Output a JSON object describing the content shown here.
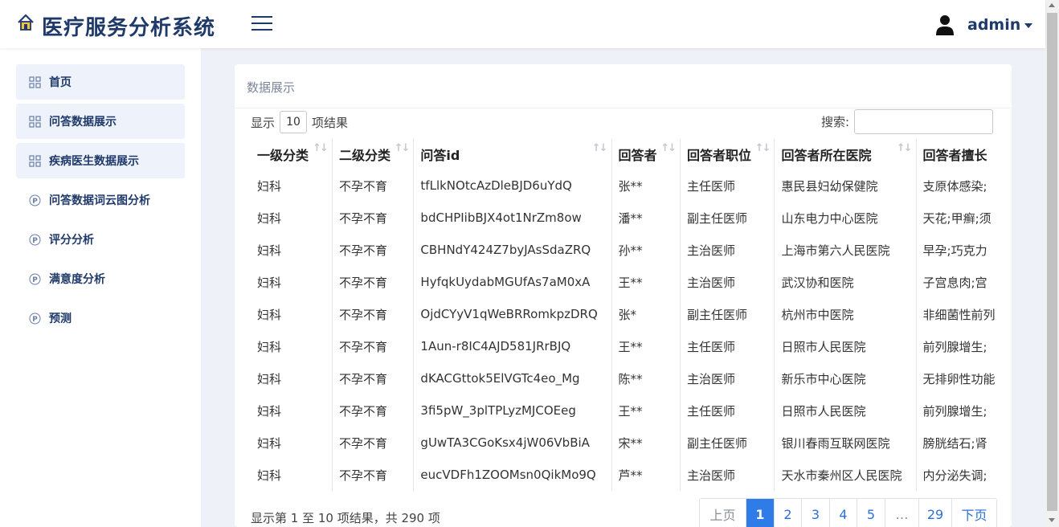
{
  "app": {
    "title": "医疗服务分析系统",
    "user_name": "admin"
  },
  "sidebar": {
    "items": [
      {
        "label": "首页"
      },
      {
        "label": "问答数据展示"
      },
      {
        "label": "疾病医生数据展示"
      },
      {
        "label": "问答数据词云图分析"
      },
      {
        "label": "评分分析"
      },
      {
        "label": "满意度分析"
      },
      {
        "label": "预测"
      }
    ]
  },
  "panel": {
    "title": "数据展示",
    "length_prefix": "显示",
    "length_value": "10",
    "length_suffix": "项结果",
    "search_label": "搜索:",
    "search_value": ""
  },
  "table": {
    "columns": [
      "一级分类",
      "二级分类",
      "问答id",
      "回答者",
      "回答者职位",
      "回答者所在医院",
      "回答者擅长"
    ],
    "rows": [
      [
        "妇科",
        "不孕不育",
        "tfLlkNOtcAzDleBJD6uYdQ",
        "张**",
        "主任医师",
        "惠民县妇幼保健院",
        "支原体感染;"
      ],
      [
        "妇科",
        "不孕不育",
        "bdCHPIibBJX4ot1NrZm8ow",
        "潘**",
        "副主任医师",
        "山东电力中心医院",
        "天花;甲癣;须"
      ],
      [
        "妇科",
        "不孕不育",
        "CBHNdY424Z7byJAsSdaZRQ",
        "孙**",
        "主治医师",
        "上海市第六人民医院",
        "早孕;巧克力"
      ],
      [
        "妇科",
        "不孕不育",
        "HyfqkUydabMGUfAs7aM0xA",
        "王**",
        "主治医师",
        "武汉协和医院",
        "子宫息肉;宫"
      ],
      [
        "妇科",
        "不孕不育",
        "OjdCYyV1qWeBRRomkpzDRQ",
        "张*",
        "副主任医师",
        "杭州市中医院",
        "非细菌性前列"
      ],
      [
        "妇科",
        "不孕不育",
        "1Aun-r8IC4AJD581JRrBJQ",
        "王**",
        "主任医师",
        "日照市人民医院",
        "前列腺增生;"
      ],
      [
        "妇科",
        "不孕不育",
        "dKACGttok5ElVGTc4eo_Mg",
        "陈**",
        "主治医师",
        "新乐市中心医院",
        "无排卵性功能"
      ],
      [
        "妇科",
        "不孕不育",
        "3fi5pW_3plTPLyzMJCOEeg",
        "王**",
        "主任医师",
        "日照市人民医院",
        "前列腺增生;"
      ],
      [
        "妇科",
        "不孕不育",
        "gUwTA3CGoKsx4jW06VbBiA",
        "宋**",
        "副主任医师",
        "银川春雨互联网医院",
        "膀胱结石;肾"
      ],
      [
        "妇科",
        "不孕不育",
        "eucVDFh1ZOOMsn0QikMo9Q",
        "芦**",
        "主治医师",
        "天水市秦州区人民医院",
        "内分泌失调;"
      ]
    ]
  },
  "footer": {
    "info": "显示第 1 至 10 项结果，共 290 项",
    "pages": [
      "上页",
      "1",
      "2",
      "3",
      "4",
      "5",
      "…",
      "29",
      "下页"
    ],
    "current_page": "1"
  }
}
